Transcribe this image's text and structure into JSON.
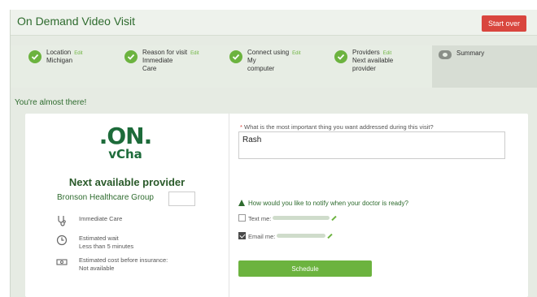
{
  "window": {
    "title": "On Demand Video Visit",
    "start_over": "Start over"
  },
  "steps": [
    {
      "label": "Location",
      "edit": "Edit",
      "value": "Michigan"
    },
    {
      "label": "Reason for visit",
      "edit": "Edit",
      "value": "Immediate Care"
    },
    {
      "label": "Connect using",
      "edit": "Edit",
      "value": "My computer"
    },
    {
      "label": "Providers",
      "edit": "Edit",
      "value": "Next available provider"
    }
  ],
  "summary_label": "Summary",
  "almost_there": "You're almost there!",
  "provider": {
    "logo_line1": ".ON.",
    "logo_line2": "vCha",
    "title": "Next available provider",
    "org": "Bronson Healthcare Group",
    "care_type": "Immediate Care",
    "wait_label": "Estimated wait",
    "wait_value": "Less than 5 minutes",
    "cost_label": "Estimated cost before insurance:",
    "cost_value": "Not available"
  },
  "form": {
    "question_required": "*",
    "question": "What is the most important thing you want addressed during this visit?",
    "answer": "Rash",
    "notify_question": "How would you like to notify when your doctor is ready?",
    "text_label": "Text me:",
    "text_checked": false,
    "email_label": "Email me:",
    "email_checked": true,
    "schedule_label": "Schedule"
  },
  "colors": {
    "accent_green": "#6cb33f",
    "heading_green": "#2e6b2e",
    "danger_red": "#d9463e"
  }
}
